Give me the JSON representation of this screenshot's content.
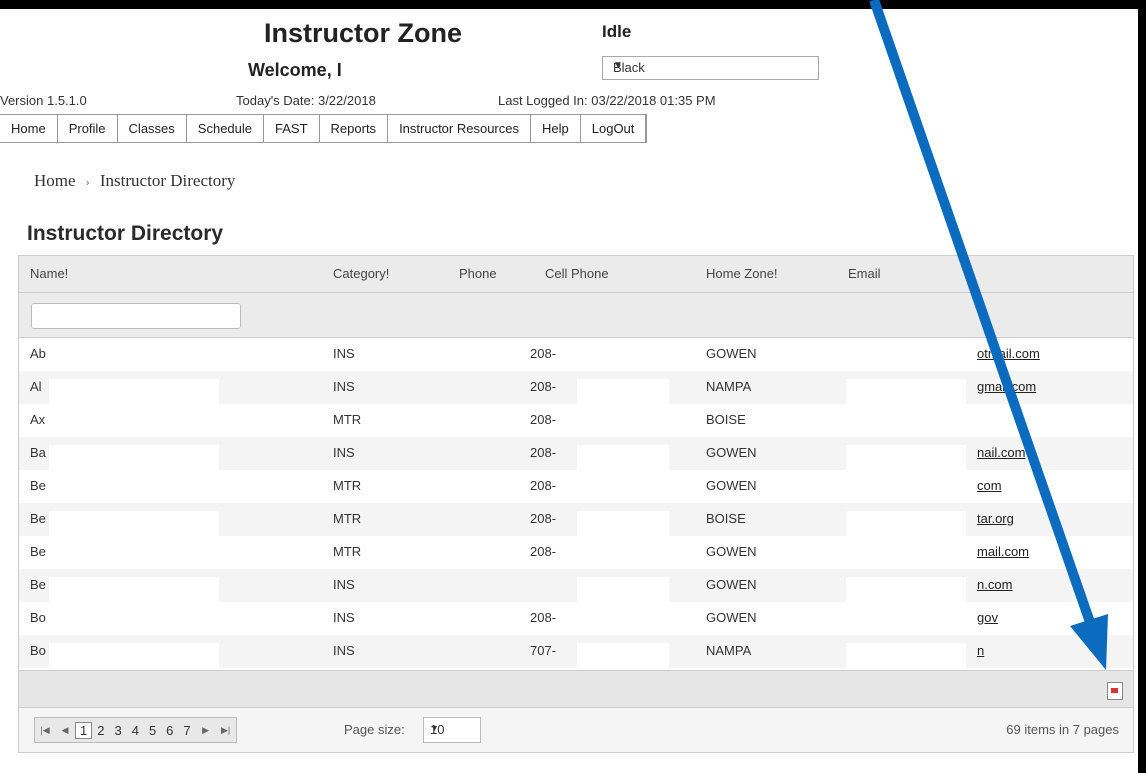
{
  "header": {
    "title": "Instructor Zone",
    "welcome": "Welcome, I",
    "status": "Idle",
    "theme_select": "Black",
    "version": "Version 1.5.1.0",
    "todays_date": "Today's Date: 3/22/2018",
    "last_logged": "Last Logged In: 03/22/2018 01:35 PM"
  },
  "nav": [
    "Home",
    "Profile",
    "Classes",
    "Schedule",
    "FAST",
    "Reports",
    "Instructor Resources",
    "Help",
    "LogOut"
  ],
  "breadcrumb": {
    "home": "Home",
    "sep": "›",
    "current": "Instructor Directory"
  },
  "page_title": "Instructor Directory",
  "grid": {
    "columns": [
      "Name!",
      "Category!",
      "Phone",
      "Cell Phone",
      "Home Zone!",
      "Email"
    ],
    "filter_value": "",
    "rows": [
      {
        "name": "Ab",
        "category": "INS",
        "cell": "208-",
        "zone": "GOWEN",
        "email": "otmail.com"
      },
      {
        "name": "Al",
        "category": "INS",
        "cell": "208-",
        "zone": "NAMPA",
        "email": "gmail.com"
      },
      {
        "name": "Ax",
        "category": "MTR",
        "cell": "208-",
        "zone": "BOISE",
        "email": ""
      },
      {
        "name": "Ba",
        "category": "INS",
        "cell": "208-",
        "zone": "GOWEN",
        "email": "nail.com"
      },
      {
        "name": "Be",
        "category": "MTR",
        "cell": "208-",
        "zone": "GOWEN",
        "email": "com"
      },
      {
        "name": "Be",
        "category": "MTR",
        "cell": "208-",
        "zone": "BOISE",
        "email": "tar.org"
      },
      {
        "name": "Be",
        "category": "MTR",
        "cell": "208-",
        "zone": "GOWEN",
        "email": "mail.com"
      },
      {
        "name": "Be",
        "category": "INS",
        "cell": "",
        "zone": "GOWEN",
        "email": "n.com"
      },
      {
        "name": "Bo",
        "category": "INS",
        "cell": "208-",
        "zone": "GOWEN",
        "email": "gov"
      },
      {
        "name": "Bo",
        "category": "INS",
        "cell": "707-",
        "zone": "NAMPA",
        "email": "n"
      }
    ],
    "export_icon": "pdf-export-icon",
    "pager": {
      "pages": [
        "1",
        "2",
        "3",
        "4",
        "5",
        "6",
        "7"
      ],
      "current": "1",
      "page_size_label": "Page size:",
      "page_size": "10",
      "summary": "69 items in 7 pages"
    }
  },
  "colors": {
    "arrow": "#0a6bbf",
    "frame": "#000000"
  }
}
